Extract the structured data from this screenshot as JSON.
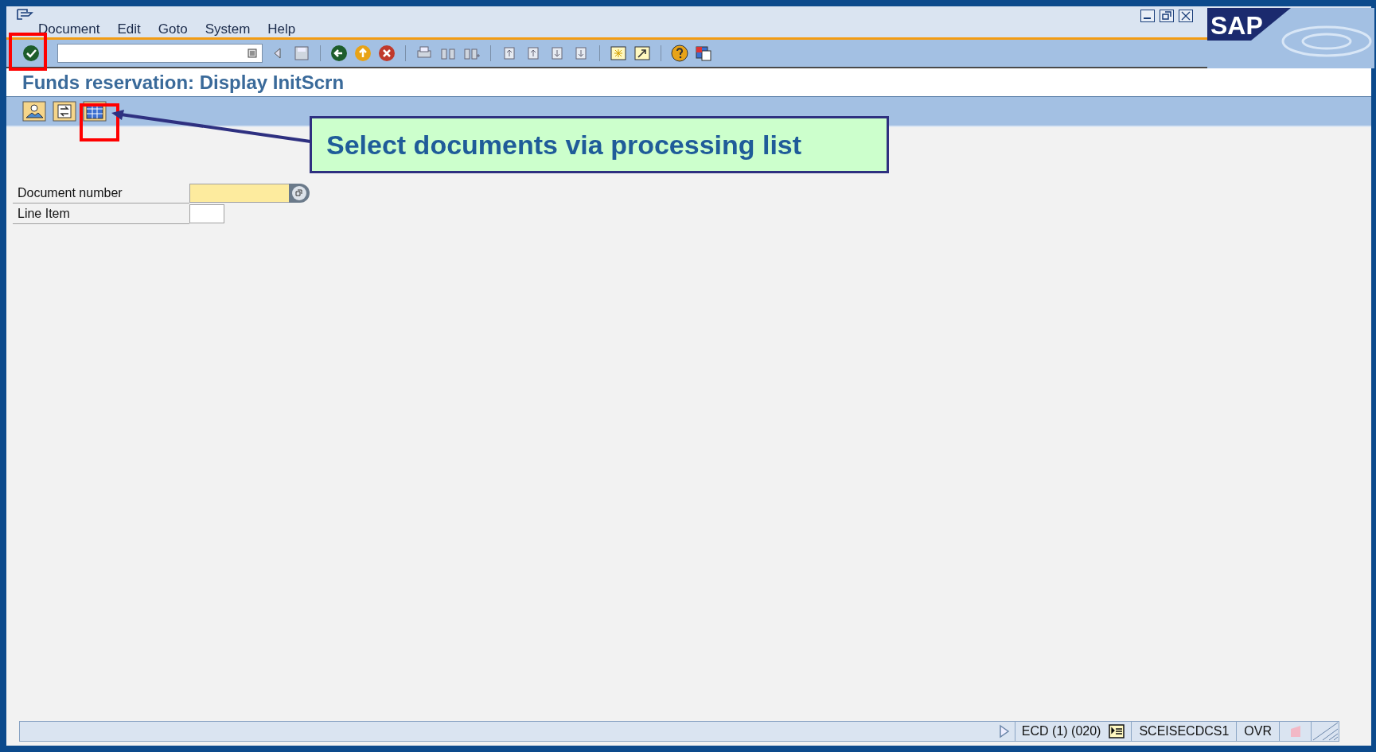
{
  "menu": [
    "Document",
    "Edit",
    "Goto",
    "System",
    "Help"
  ],
  "logo": "SAP",
  "title": "Funds reservation: Display InitScrn",
  "fields": [
    {
      "label": "Document number",
      "required": true,
      "has_search_help": true
    },
    {
      "label": "Line Item",
      "required": false,
      "has_search_help": false
    }
  ],
  "callout": "Select documents via processing list",
  "status_bar": {
    "system": "ECD (1) (020)",
    "server": "SCEISECDCS1",
    "mode": "OVR"
  }
}
